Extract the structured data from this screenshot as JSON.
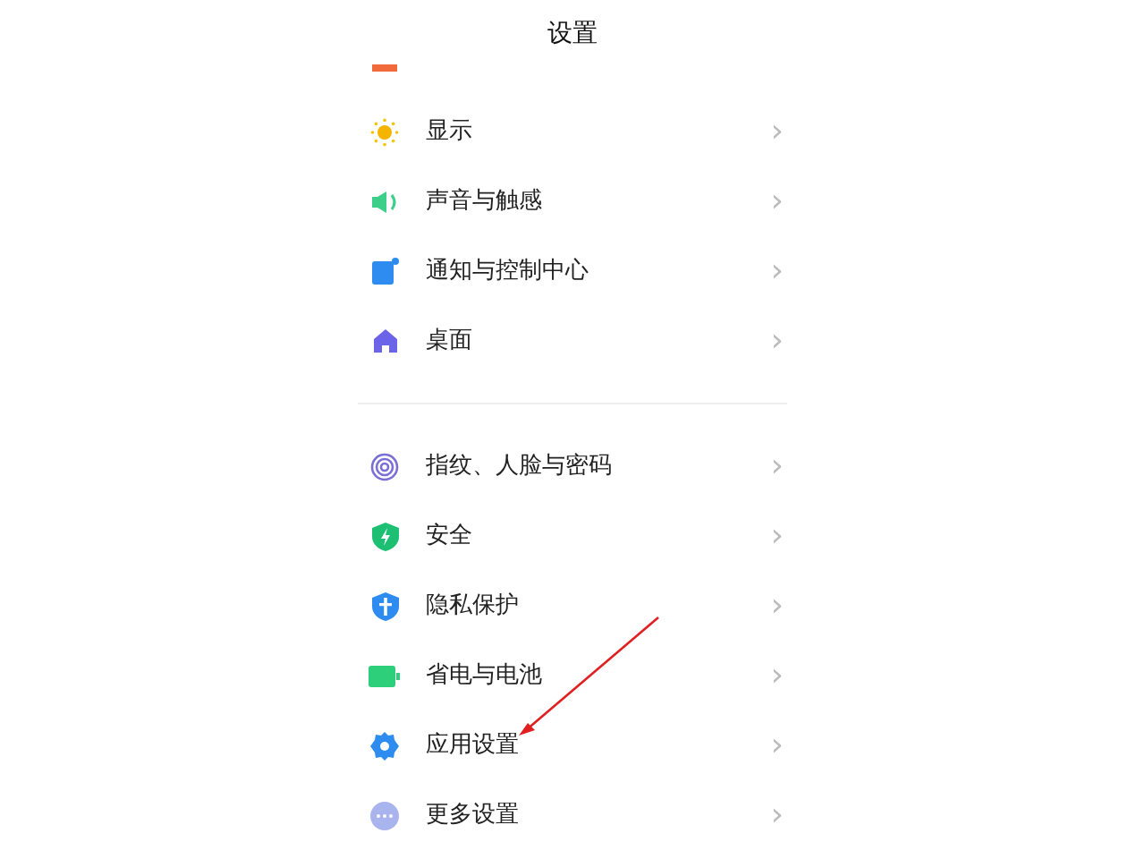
{
  "header": {
    "title": "设置"
  },
  "groups": [
    {
      "items": [
        {
          "kind": "sun",
          "label": "显示",
          "chevron": "›"
        },
        {
          "kind": "speaker",
          "label": "声音与触感",
          "chevron": "›"
        },
        {
          "kind": "notification",
          "label": "通知与控制中心",
          "chevron": "›"
        },
        {
          "kind": "home",
          "label": "桌面",
          "chevron": "›"
        }
      ]
    },
    {
      "items": [
        {
          "kind": "fingerprint",
          "label": "指纹、人脸与密码",
          "chevron": "›"
        },
        {
          "kind": "shield",
          "label": "安全",
          "chevron": "›"
        },
        {
          "kind": "privacy",
          "label": "隐私保护",
          "chevron": "›"
        },
        {
          "kind": "battery",
          "label": "省电与电池",
          "chevron": "›"
        },
        {
          "kind": "gear",
          "label": "应用设置",
          "chevron": "›"
        },
        {
          "kind": "more",
          "label": "更多设置",
          "chevron": "›"
        }
      ]
    }
  ]
}
